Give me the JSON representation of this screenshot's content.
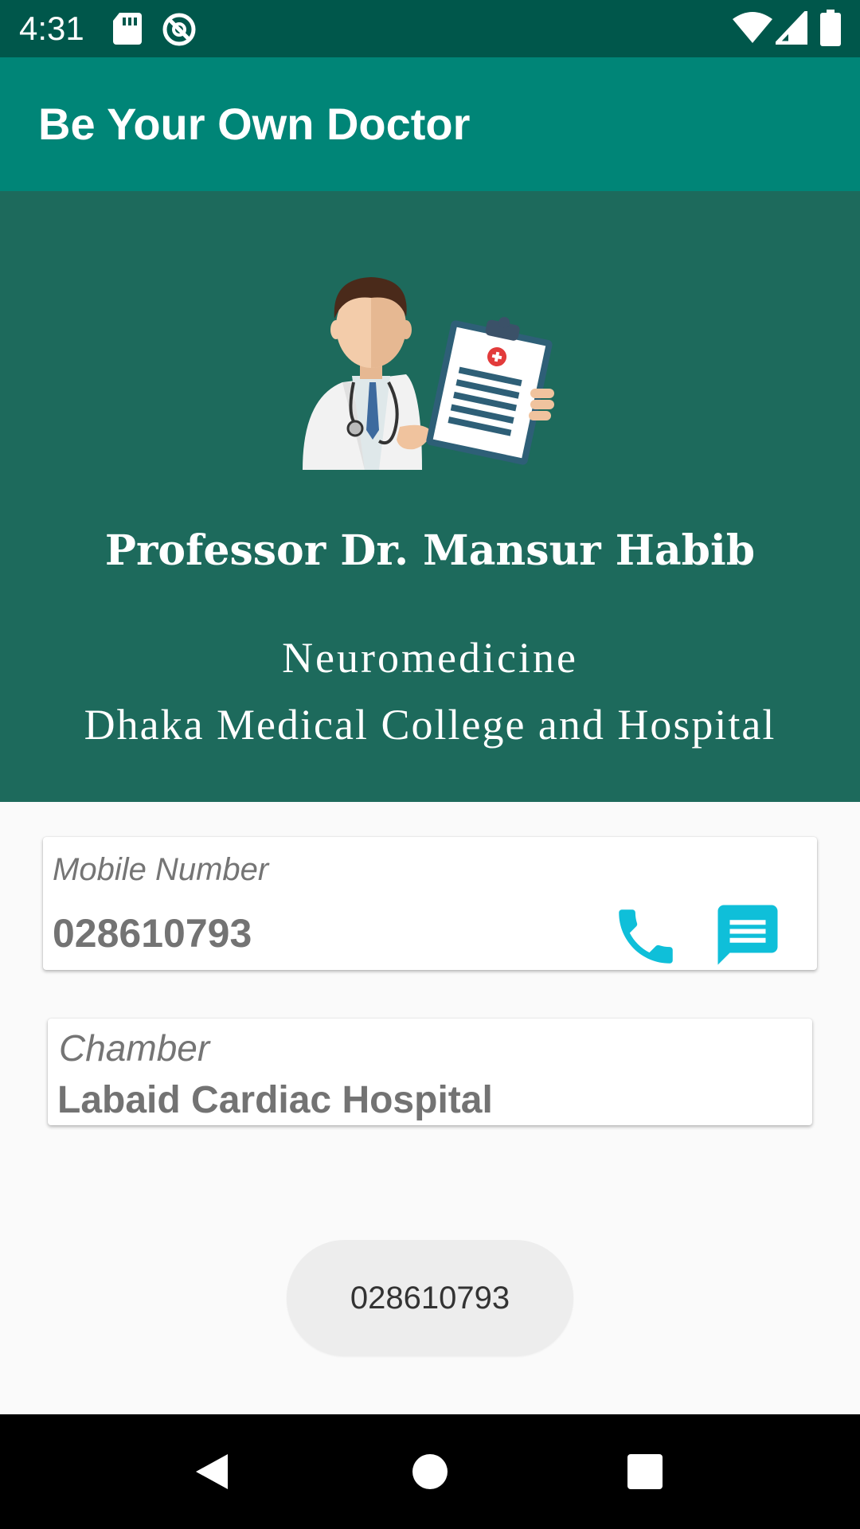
{
  "status_bar": {
    "time": "4:31",
    "left_icons": [
      "sd-card-icon",
      "no-sync-icon"
    ],
    "right_icons": [
      "wifi-icon",
      "cell-signal-icon",
      "battery-icon"
    ]
  },
  "app_bar": {
    "title": "Be Your Own Doctor"
  },
  "profile": {
    "name": "Professor Dr. Mansur Habib",
    "specialty": "Neuromedicine",
    "hospital": "Dhaka Medical College and Hospital",
    "illustration": "doctor-with-clipboard-icon"
  },
  "mobile_card": {
    "label": "Mobile Number",
    "value": "028610793",
    "actions": [
      "phone-call-icon",
      "message-icon"
    ]
  },
  "chamber_card": {
    "label": "Chamber",
    "value": "Labaid Cardiac Hospital"
  },
  "toast": {
    "text": "028610793"
  },
  "nav_bar": {
    "buttons": [
      "back-icon",
      "home-icon",
      "recents-icon"
    ]
  },
  "colors": {
    "status_bar": "#00574b",
    "app_bar": "#008577",
    "hero_bg": "#1d6a5c",
    "action_icon": "#0fbfd9",
    "page_bg": "#fafafa"
  }
}
